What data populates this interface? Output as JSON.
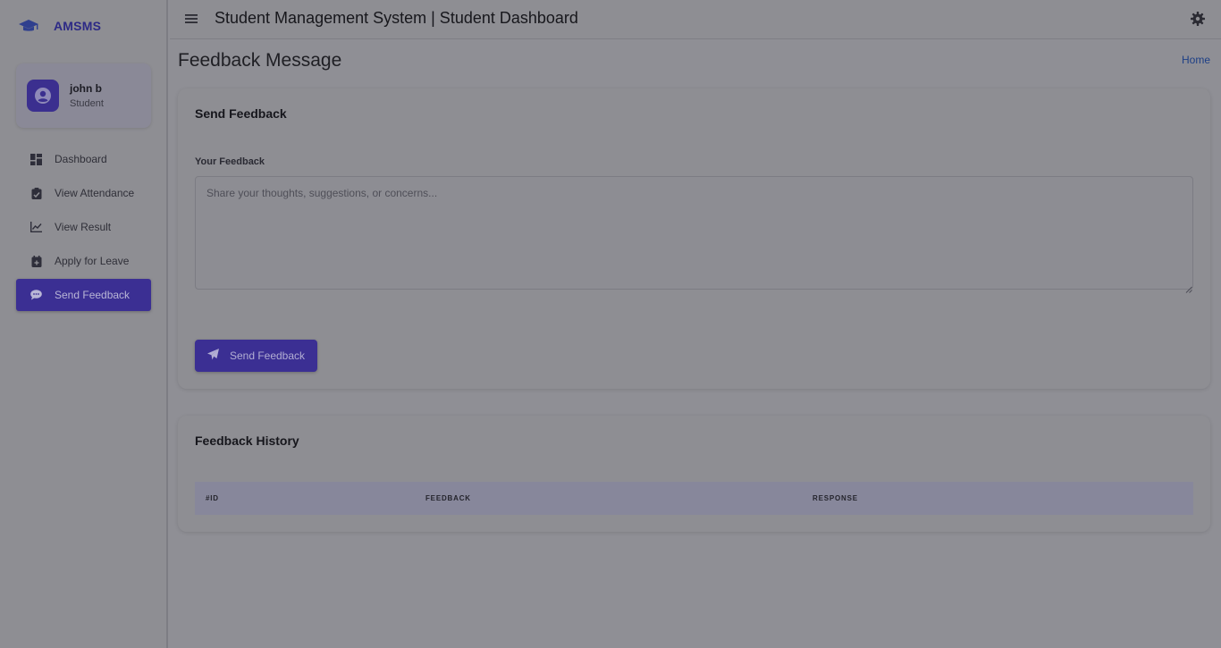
{
  "brand": {
    "name": "AMSMS"
  },
  "user": {
    "name": "john b",
    "role": "Student"
  },
  "sidebar": {
    "items": [
      {
        "label": "Dashboard",
        "icon": "dashboard-icon"
      },
      {
        "label": "View Attendance",
        "icon": "clipboard-check-icon"
      },
      {
        "label": "View Result",
        "icon": "chart-line-icon"
      },
      {
        "label": "Apply for Leave",
        "icon": "calendar-plus-icon"
      },
      {
        "label": "Send Feedback",
        "icon": "comment-icon",
        "active": true
      }
    ]
  },
  "topbar": {
    "title": "Student Management System | Student Dashboard"
  },
  "page": {
    "title": "Feedback Message",
    "breadcrumb": "Home"
  },
  "feedback_form": {
    "title": "Send Feedback",
    "label": "Your Feedback",
    "placeholder": "Share your thoughts, suggestions, or concerns...",
    "value": "",
    "submit_label": "Send Feedback"
  },
  "history": {
    "title": "Feedback History",
    "columns": [
      "#ID",
      "FEEDBACK",
      "RESPONSE"
    ],
    "rows": []
  },
  "colors": {
    "accent": "#3b2f93",
    "brand_text": "#2d2a86",
    "link": "#1d3f86"
  }
}
